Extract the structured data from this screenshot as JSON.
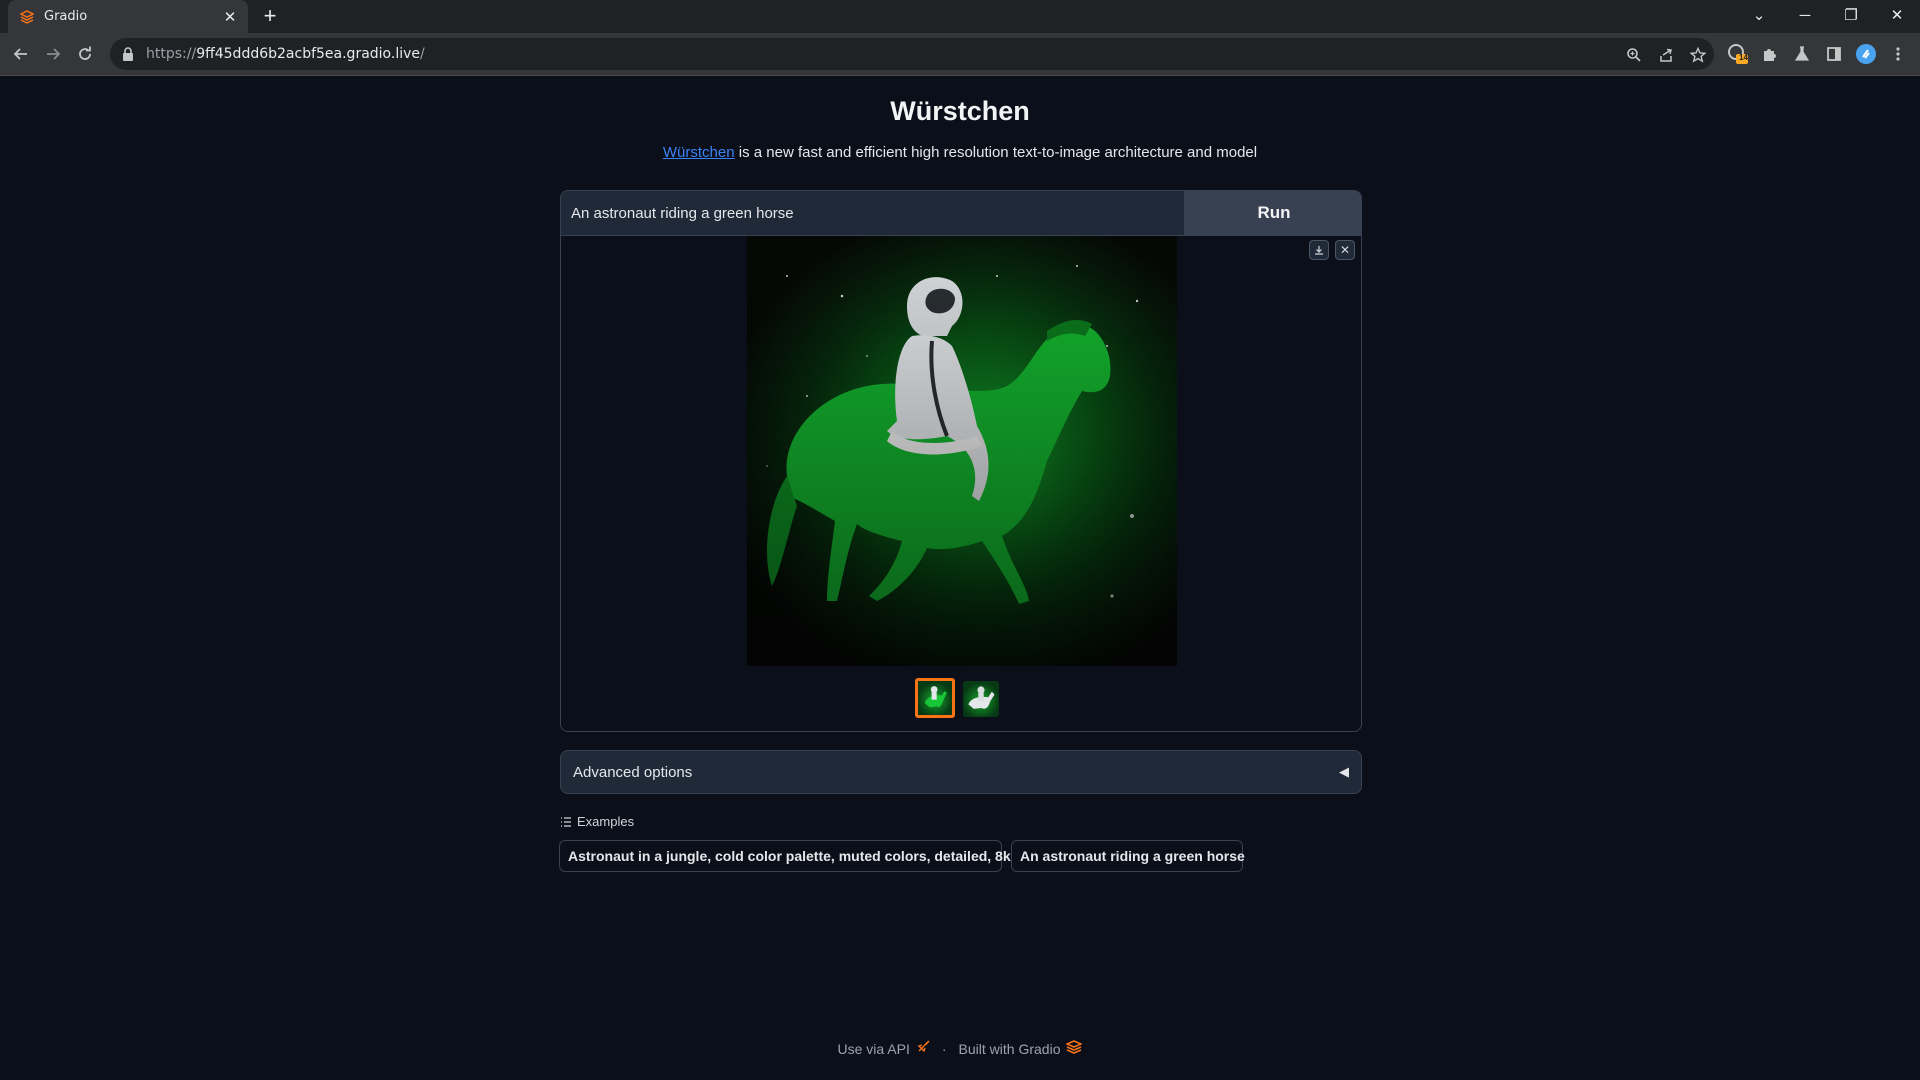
{
  "browser": {
    "tab_title": "Gradio",
    "url_prefix": "https://",
    "url_host": "9ff45ddd6b2acbf5ea.gradio.live",
    "url_suffix": "/",
    "extension_badge": "14"
  },
  "page": {
    "title": "Würstchen",
    "subtitle_link": "Würstchen",
    "subtitle_text": " is a new fast and efficient high resolution text-to-image architecture and model"
  },
  "prompt": {
    "value": "An astronaut riding a green horse",
    "run_label": "Run"
  },
  "accordion": {
    "label": "Advanced options"
  },
  "examples": {
    "header": "Examples",
    "items": [
      "Astronaut in a jungle, cold color palette, muted colors, detailed, 8k",
      "An astronaut riding a green horse"
    ]
  },
  "footer": {
    "api_label": "Use via API",
    "separator": "·",
    "built_label": "Built with Gradio"
  },
  "colors": {
    "background": "#0b0f19",
    "panel": "#1f2937",
    "border": "#374151",
    "accent": "#f97316",
    "link": "#3b82f6"
  }
}
